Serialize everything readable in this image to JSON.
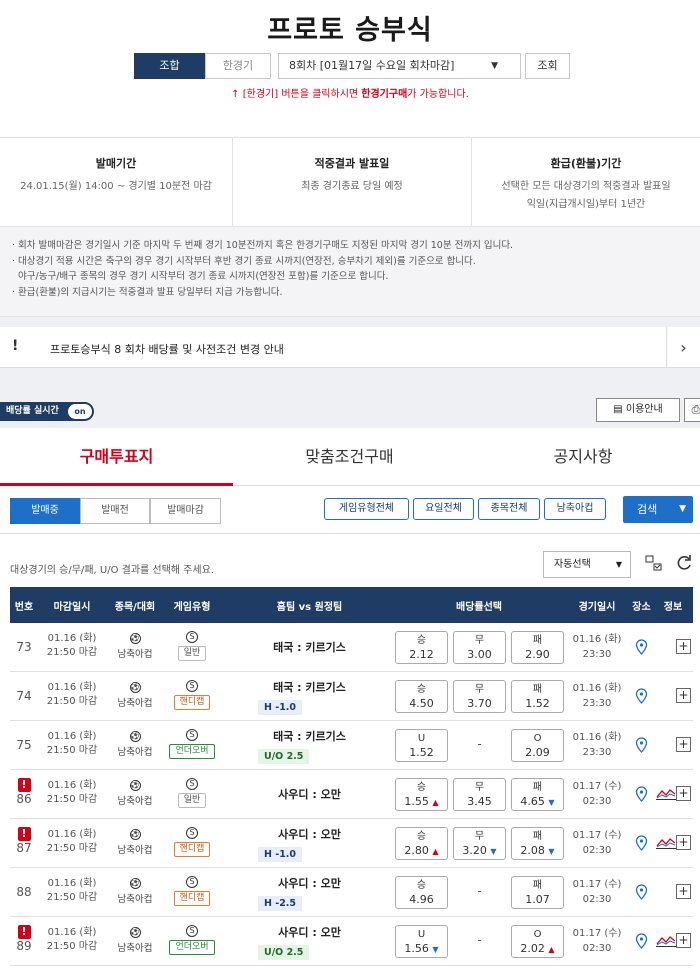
{
  "header": {
    "title": "프로토 승부식",
    "tab_combo": "조합",
    "tab_single": "한경기",
    "round_select": "8회차 [01월17일 수요일 회차마감]",
    "search_btn": "조회",
    "hint_arrow": "↑",
    "hint_pre": "[한경기] 버튼을 클릭하시면 ",
    "hint_bold": "한경기구매",
    "hint_post": "가 가능합니다."
  },
  "info": {
    "sale_period_title": "발매기간",
    "sale_period_text": "24.01.15(월) 14:00 ~ 경기별 10분전 마감",
    "result_title": "적중결과 발표일",
    "result_text": "최종 경기종료 당일 예정",
    "refund_title": "환급(환불)기간",
    "refund_text1": "선택한 모든 대상경기의 적중결과 발표일",
    "refund_text2": "익일(지급개시일)부터 1년간"
  },
  "notes": [
    "· 회차 발매마감은 경기일시 기준 마지막 두 번째 경기 10분전까지 혹은 한경기구매도 지정된 마지막 경기 10분 전까지 입니다.",
    "· 대상경기 적용 시간은 축구의 경우 경기 시작부터 후반 경기 종료 시까지(연장전, 승부차기 제외)를 기준으로 합니다.",
    "  야구/농구/배구 종목의 경우 경기 시작부터 경기 종료 시까지(연장전 포함)를 기준으로 합니다.",
    "· 환급(환불)의 지급시기는 적중결과 발표 당일부터 지급 가능합니다."
  ],
  "notice": {
    "bang": "!",
    "text": "프로토승부식 8 회차 배당률 및 사전조건 변경 안내",
    "arrow": "›"
  },
  "toolbar": {
    "live_label": "배당률 실시간",
    "live_state": "on",
    "guide_btn": "이용안내",
    "guide_icon": "▤",
    "print_icon": "⎙"
  },
  "main_tabs": {
    "buy": "구매투표지",
    "cond": "맞춤조건구매",
    "notice": "공지사항"
  },
  "status_tabs": {
    "on_sale": "발매중",
    "pre_sale": "발매전",
    "closed": "발매마감"
  },
  "filters": {
    "game_type": "게임유형전체",
    "day": "요일전체",
    "sport": "종목전체",
    "league": "남축아컵",
    "search": "검색",
    "search_chevron": "▼"
  },
  "instruction": "대상경기의 승/무/패, U/O 결과를 선택해 주세요.",
  "auto_select": "자동선택",
  "auto_chevron": "▼",
  "table": {
    "headers": {
      "no": "번호",
      "deadline": "마감일시",
      "league": "종목/대회",
      "game_type": "게임유형",
      "match": "홈팀 vs 원정팀",
      "odds": "배당률선택",
      "match_time": "경기일시",
      "venue": "장소",
      "info": "정보"
    },
    "rows": [
      {
        "no": "73",
        "warn": false,
        "deadline_date": "01.16 (화)",
        "deadline_time": "21:50 마감",
        "league": "남축아컵",
        "type_icon": "S",
        "type_label": "일반",
        "type_kind": "normal",
        "match": "태국 : 키르기스",
        "sub": "",
        "sub_kind": "",
        "odds": [
          {
            "label": "승",
            "value": "2.12",
            "trend": ""
          },
          {
            "label": "무",
            "value": "3.00",
            "trend": ""
          },
          {
            "label": "패",
            "value": "2.90",
            "trend": ""
          }
        ],
        "date": "01.16 (화)",
        "time": "23:30",
        "chart": false
      },
      {
        "no": "74",
        "warn": false,
        "deadline_date": "01.16 (화)",
        "deadline_time": "21:50 마감",
        "league": "남축아컵",
        "type_icon": "S",
        "type_label": "핸디캡",
        "type_kind": "ha",
        "match": "태국 : 키르기스",
        "sub": "H -1.0",
        "sub_kind": "h",
        "odds": [
          {
            "label": "승",
            "value": "4.50",
            "trend": ""
          },
          {
            "label": "무",
            "value": "3.70",
            "trend": ""
          },
          {
            "label": "패",
            "value": "1.52",
            "trend": ""
          }
        ],
        "date": "01.16 (화)",
        "time": "23:30",
        "chart": false
      },
      {
        "no": "75",
        "warn": false,
        "deadline_date": "01.16 (화)",
        "deadline_time": "21:50 마감",
        "league": "남축아컵",
        "type_icon": "S",
        "type_label": "언더오버",
        "type_kind": "uo",
        "match": "태국 : 키르기스",
        "sub": "U/O 2.5",
        "sub_kind": "uo",
        "odds": [
          {
            "label": "U",
            "value": "1.52",
            "trend": ""
          },
          {
            "label": "-",
            "value": "",
            "trend": ""
          },
          {
            "label": "O",
            "value": "2.09",
            "trend": ""
          }
        ],
        "date": "01.16 (화)",
        "time": "23:30",
        "chart": false
      },
      {
        "no": "86",
        "warn": true,
        "deadline_date": "01.16 (화)",
        "deadline_time": "21:50 마감",
        "league": "남축아컵",
        "type_icon": "S",
        "type_label": "일반",
        "type_kind": "normal",
        "match": "사우디 : 오만",
        "sub": "",
        "sub_kind": "",
        "odds": [
          {
            "label": "승",
            "value": "1.55",
            "trend": "up"
          },
          {
            "label": "무",
            "value": "3.45",
            "trend": ""
          },
          {
            "label": "패",
            "value": "4.65",
            "trend": "down"
          }
        ],
        "date": "01.17 (수)",
        "time": "02:30",
        "chart": true
      },
      {
        "no": "87",
        "warn": true,
        "deadline_date": "01.16 (화)",
        "deadline_time": "21:50 마감",
        "league": "남축아컵",
        "type_icon": "S",
        "type_label": "핸디캡",
        "type_kind": "ha",
        "match": "사우디 : 오만",
        "sub": "H -1.0",
        "sub_kind": "h",
        "odds": [
          {
            "label": "승",
            "value": "2.80",
            "trend": "up"
          },
          {
            "label": "무",
            "value": "3.20",
            "trend": "down"
          },
          {
            "label": "패",
            "value": "2.08",
            "trend": "down"
          }
        ],
        "date": "01.17 (수)",
        "time": "02:30",
        "chart": true
      },
      {
        "no": "88",
        "warn": false,
        "deadline_date": "01.16 (화)",
        "deadline_time": "21:50 마감",
        "league": "남축아컵",
        "type_icon": "S",
        "type_label": "핸디캡",
        "type_kind": "ha",
        "match": "사우디 : 오만",
        "sub": "H -2.5",
        "sub_kind": "h",
        "odds": [
          {
            "label": "승",
            "value": "4.96",
            "trend": ""
          },
          {
            "label": "-",
            "value": "",
            "trend": ""
          },
          {
            "label": "패",
            "value": "1.07",
            "trend": ""
          }
        ],
        "date": "01.17 (수)",
        "time": "02:30",
        "chart": false
      },
      {
        "no": "89",
        "warn": true,
        "deadline_date": "01.16 (화)",
        "deadline_time": "21:50 마감",
        "league": "남축아컵",
        "type_icon": "S",
        "type_label": "언더오버",
        "type_kind": "uo",
        "match": "사우디 : 오만",
        "sub": "U/O 2.5",
        "sub_kind": "uo",
        "odds": [
          {
            "label": "U",
            "value": "1.56",
            "trend": "down"
          },
          {
            "label": "-",
            "value": "",
            "trend": ""
          },
          {
            "label": "O",
            "value": "2.02",
            "trend": "up"
          }
        ],
        "date": "01.17 (수)",
        "time": "02:30",
        "chart": true
      }
    ],
    "warn_glyph": "!",
    "plus_glyph": "+",
    "venue_glyph": "⌖",
    "up_glyph": "▲",
    "down_glyph": "▼"
  }
}
